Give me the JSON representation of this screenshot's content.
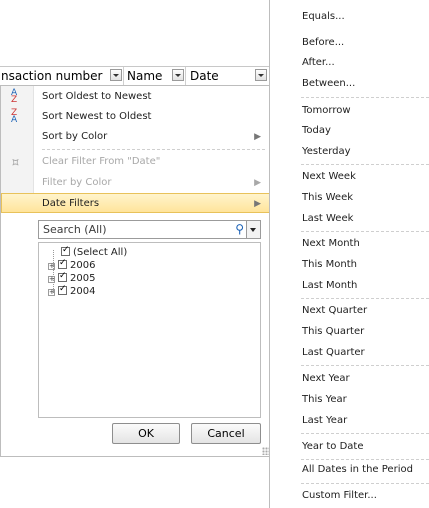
{
  "header": {
    "columns": [
      "nsaction number",
      "Name",
      "Date"
    ]
  },
  "filter_menu": {
    "items": [
      {
        "label": "Sort Oldest to Newest",
        "enabled": true,
        "icon": "sort-ascending-icon"
      },
      {
        "label": "Sort Newest to Oldest",
        "enabled": true,
        "icon": "sort-descending-icon"
      },
      {
        "label": "Sort by Color",
        "enabled": true,
        "submenu": true
      },
      {
        "label": "Clear Filter From \"Date\"",
        "enabled": false,
        "icon": "clear-filter-icon"
      },
      {
        "label": "Filter by Color",
        "enabled": false,
        "submenu": true
      },
      {
        "label": "Date Filters",
        "enabled": true,
        "submenu": true,
        "highlighted": true
      }
    ],
    "search_placeholder": "Search (All)",
    "tree": [
      {
        "label": "(Select All)",
        "checked": true
      },
      {
        "label": "2006",
        "checked": true,
        "expandable": true
      },
      {
        "label": "2005",
        "checked": true,
        "expandable": true
      },
      {
        "label": "2004",
        "checked": true,
        "expandable": true
      }
    ],
    "ok_label": "OK",
    "cancel_label": "Cancel"
  },
  "date_filters_submenu": {
    "items": [
      "Equals...",
      "Before...",
      "After...",
      "Between...",
      "Tomorrow",
      "Today",
      "Yesterday",
      "Next Week",
      "This Week",
      "Last Week",
      "Next Month",
      "This Month",
      "Last Month",
      "Next Quarter",
      "This Quarter",
      "Last Quarter",
      "Next Year",
      "This Year",
      "Last Year",
      "Year to Date",
      "All Dates in the Period",
      "Custom Filter..."
    ]
  },
  "colors": {
    "highlight": "#ffe49b",
    "disabled_text": "#a8a8a8",
    "search_icon": "#1c62b6"
  }
}
